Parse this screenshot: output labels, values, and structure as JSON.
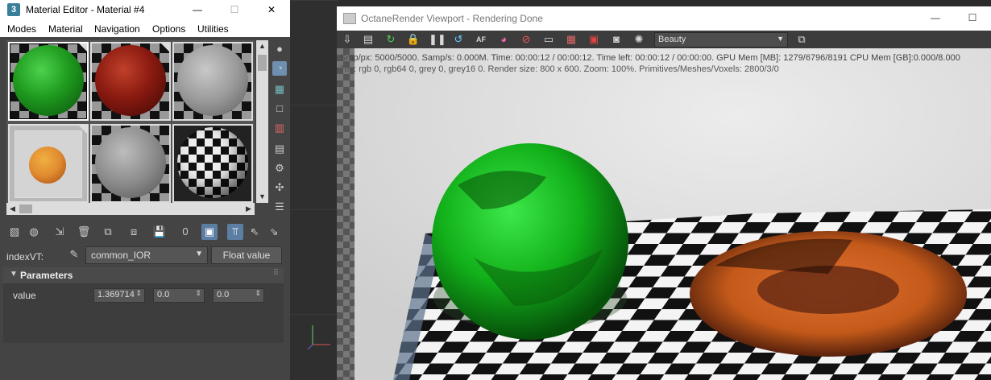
{
  "material_editor": {
    "title": "Material Editor - Material #4",
    "menu": [
      "Modes",
      "Material",
      "Navigation",
      "Options",
      "Utilities"
    ],
    "window_buttons": {
      "minimize": "—",
      "maximize": "☐",
      "close": "✕"
    },
    "slots": [
      {
        "name": "green-glass-sphere",
        "color": "#1e9a1e"
      },
      {
        "name": "red-glass-sphere",
        "color": "#8a1a10"
      },
      {
        "name": "grey-sphere",
        "color": "#9a9a9a"
      },
      {
        "name": "orange-sphere-cube",
        "color": "#e08a30"
      },
      {
        "name": "grey-sphere-2",
        "color": "#8c8c8c"
      },
      {
        "name": "checker-sphere",
        "color": "#000000"
      }
    ],
    "index_label": "indexVT:",
    "map_value": "common_IOR",
    "float_button": "Float value",
    "parameters_title": "Parameters",
    "value_label": "value",
    "spinners": [
      "1.369714",
      "0.0",
      "0.0"
    ]
  },
  "octane": {
    "title": "OctaneRender Viewport - Rendering Done",
    "window_buttons": {
      "minimize": "—",
      "maximize": "☐"
    },
    "pass_value": "Beauty",
    "stats_line1": "Smp/px: 5000/5000.   Samp/s: 0.000M.   Time: 00:00:12 / 00:00:12.   Time left: 00:00:12 / 00:00:00.   GPU Mem [MB]: 1279/6796/8191   CPU Mem [GB]:0.000/8.000",
    "stats_line2": "Tex: rgb 0, rgb64 0, grey 0, grey16 0.   Render size: 800 x 600.   Zoom: 100%.   Primitives/Meshes/Voxels: 2800/3/0",
    "toolbar_icons": [
      "save-render-icon",
      "clipboard-icon",
      "restart-icon",
      "lock-icon",
      "pause-icon",
      "refresh-icon",
      "af-icon",
      "color-picker-icon",
      "no-entry-icon",
      "display-icon",
      "printer-icon",
      "bus-icon",
      "camera-icon",
      "settings-icon",
      "export-icon"
    ]
  },
  "colors": {
    "accent_blue": "#5c7ea3",
    "green_sphere": "#12b01a",
    "torus_orange": "#c45a1a"
  }
}
